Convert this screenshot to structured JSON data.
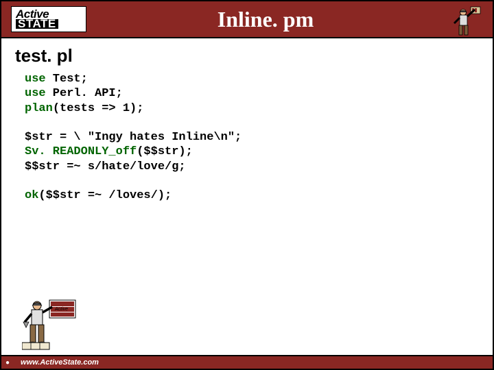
{
  "header": {
    "logo_line1": "Active",
    "logo_line2": "STATE",
    "title": "Inline. pm"
  },
  "subtitle": "test. pl",
  "code": {
    "l1a": "use",
    "l1b": " Test;",
    "l2a": "use",
    "l2b": " Perl. API;",
    "l3a": "plan",
    "l3b": "(tests => 1);",
    "blank1": "",
    "l4": "$str = \\ \"Ingy hates Inline\\n\";",
    "l5a": "Sv. READONLY_off",
    "l5b": "($$str);",
    "l6": "$$str =~ s/hate/love/g;",
    "blank2": "",
    "l7a": "ok",
    "l7b": "($$str =~ /loves/);"
  },
  "footer": {
    "url": "www.ActiveState.com",
    "bullet": "●"
  }
}
